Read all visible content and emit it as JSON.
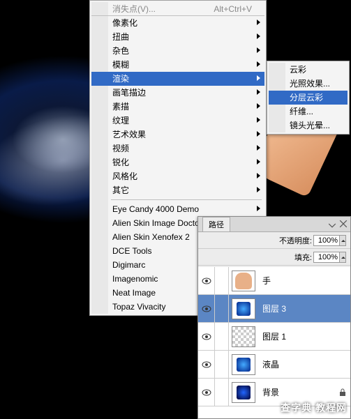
{
  "menu_top": {
    "label": "消失点(V)...",
    "shortcut": "Alt+Ctrl+V"
  },
  "menu1": [
    {
      "label": "像素化",
      "arrow": true
    },
    {
      "label": "扭曲",
      "arrow": true
    },
    {
      "label": "杂色",
      "arrow": true
    },
    {
      "label": "模糊",
      "arrow": true
    },
    {
      "label": "渲染",
      "arrow": true,
      "sel": true
    },
    {
      "label": "画笔描边",
      "arrow": true
    },
    {
      "label": "素描",
      "arrow": true
    },
    {
      "label": "纹理",
      "arrow": true
    },
    {
      "label": "艺术效果",
      "arrow": true
    },
    {
      "label": "视频",
      "arrow": true
    },
    {
      "label": "锐化",
      "arrow": true
    },
    {
      "label": "风格化",
      "arrow": true
    },
    {
      "label": "其它",
      "arrow": true
    }
  ],
  "menu1b": [
    {
      "label": "Eye Candy 4000 Demo",
      "arrow": true
    },
    {
      "label": "Alien Skin Image Doctor",
      "arrow": true
    },
    {
      "label": "Alien Skin Xenofex 2",
      "arrow": true
    },
    {
      "label": "DCE Tools",
      "arrow": true
    },
    {
      "label": "Digimarc",
      "arrow": true
    },
    {
      "label": "Imagenomic",
      "arrow": true
    },
    {
      "label": "Neat Image",
      "arrow": true
    },
    {
      "label": "Topaz Vivacity",
      "arrow": true
    }
  ],
  "menu2": [
    {
      "label": "云彩"
    },
    {
      "label": "光照效果..."
    },
    {
      "label": "分层云彩",
      "sel": true
    },
    {
      "label": "纤维..."
    },
    {
      "label": "镜头光晕..."
    }
  ],
  "panel": {
    "tab_paths": "路径",
    "opacity_label": "不透明度:",
    "opacity_val": "100%",
    "fill_label": "填充:",
    "fill_val": "100%"
  },
  "layers": [
    {
      "name": "手",
      "thumb": "hand"
    },
    {
      "name": "图层 3",
      "thumb": "blob",
      "sel": true
    },
    {
      "name": "图层 1",
      "thumb": "checker"
    },
    {
      "name": "液晶",
      "thumb": "blob2"
    },
    {
      "name": "背景",
      "thumb": "bg",
      "lock": true
    }
  ],
  "watermark": "查字典  教程网"
}
